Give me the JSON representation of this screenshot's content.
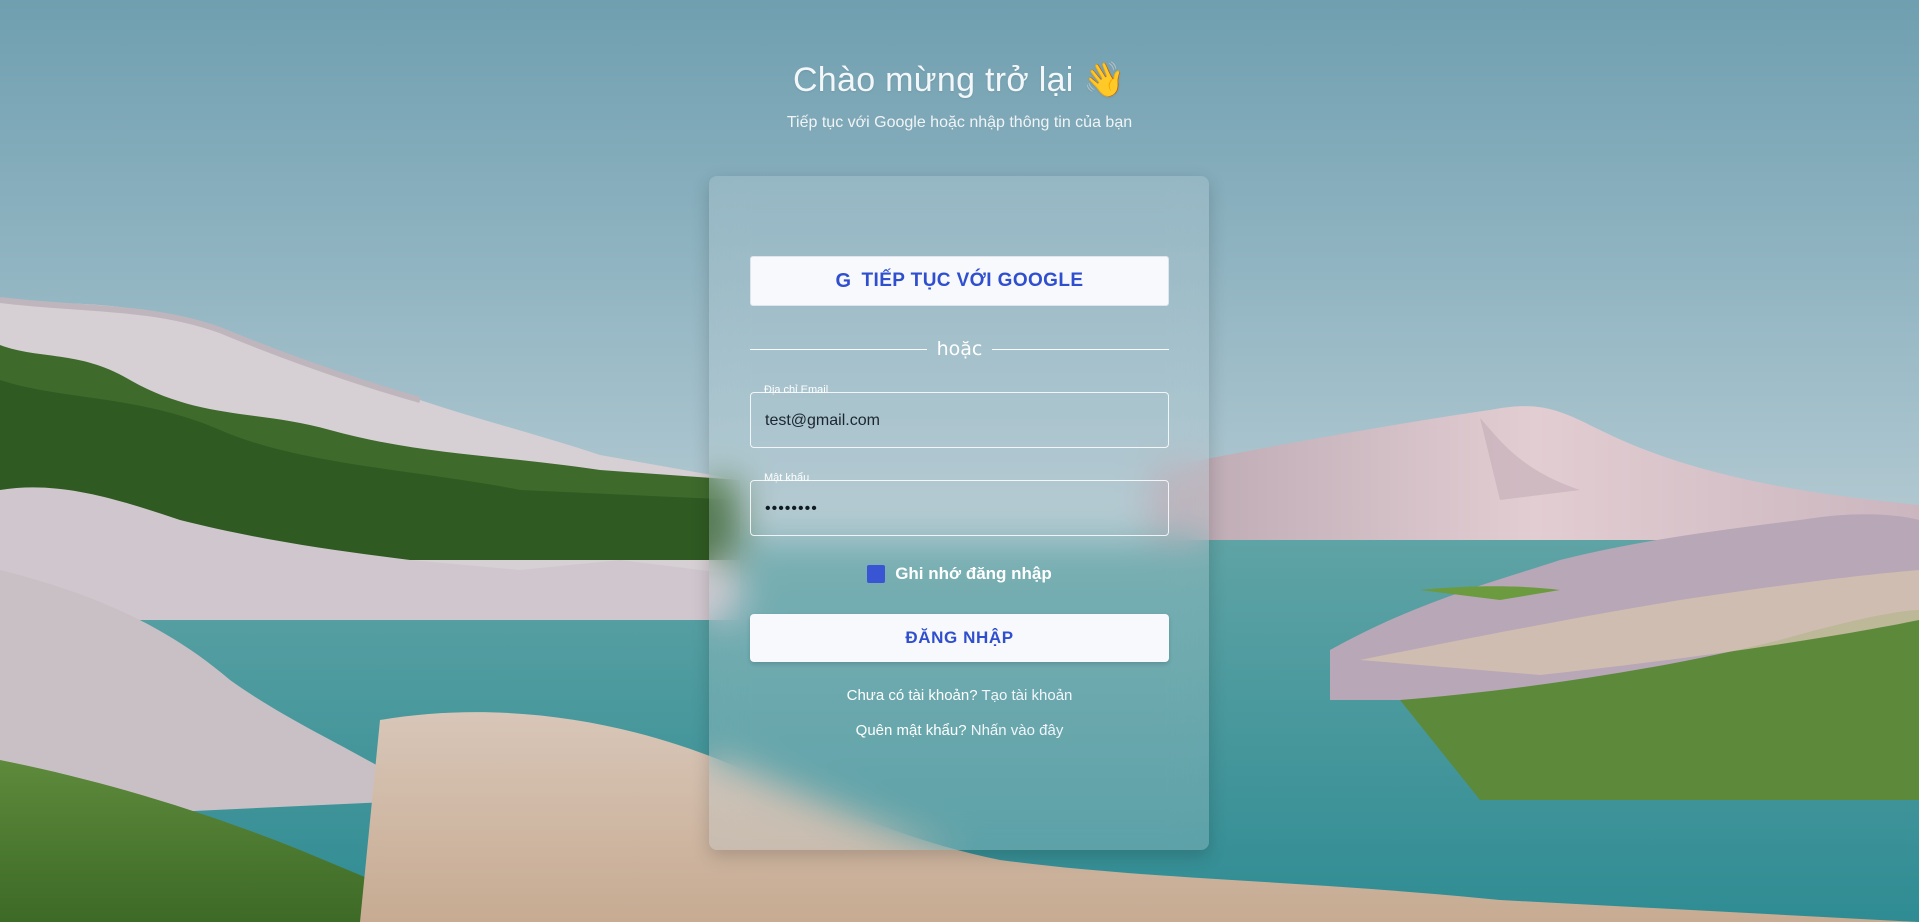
{
  "header": {
    "title": "Chào mừng trở lại 👋",
    "subtitle": "Tiếp tục với Google hoặc nhập thông tin của bạn"
  },
  "google_button": {
    "icon": "G",
    "label": "TIẾP TỤC VỚI GOOGLE"
  },
  "divider": {
    "label": "hoặc"
  },
  "email_field": {
    "label": "Địa chỉ Email",
    "value": "test@gmail.com"
  },
  "password_field": {
    "label": "Mật khẩu",
    "value": "••••••••"
  },
  "remember": {
    "label": "Ghi nhớ đăng nhập",
    "checked": true
  },
  "login_button": {
    "label": "ĐĂNG NHẬP"
  },
  "signup": {
    "prompt": "Chưa có tài khoản?",
    "link": "Tạo tài khoản"
  },
  "forgot": {
    "prompt": "Quên mật khẩu?",
    "link": "Nhấn vào đây"
  },
  "colors": {
    "accent": "#2f4fcf",
    "checkbox": "#3a55d4",
    "button_bg": "#f7f9fc"
  }
}
